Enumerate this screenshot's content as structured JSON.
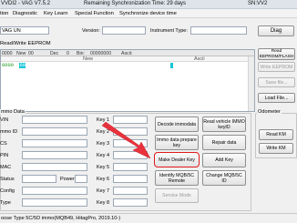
{
  "title": {
    "app": "VVDI2 - VAG V7.5.2",
    "sync": "Remaining Synchronization Time: 29 days",
    "serial": "SN:VV2"
  },
  "menu": [
    "tion",
    "Diagnostic",
    "Key Learn",
    "Special Function",
    "Synchronize device time"
  ],
  "info": {
    "vin_value": "VAG UN",
    "version_label": "Version:",
    "instrument_type_label": "Instrument Type:",
    "diag_label": "Diag"
  },
  "eeprom": {
    "title": "Read/Write EEPROM",
    "header": [
      "0000",
      "New",
      "00",
      "Dec",
      "0",
      "Bin:",
      "00000000",
      "Ascii:"
    ],
    "col_new": "New",
    "col_ascii": "Ascii",
    "row_addr": "0000",
    "row_byte": "00",
    "buttons": {
      "read": "Read\nEEPROM/FLASH",
      "write": "Write EEPROM",
      "save": "Save file...",
      "load": "Load File..."
    }
  },
  "immo": {
    "title": "mmo Data",
    "fields": [
      "VIN",
      "mmo ID",
      "CS",
      "PIN",
      "MAC",
      "Status",
      "Config",
      "Type"
    ],
    "power_label": "Power",
    "keys": [
      "Key 1",
      "Key 2",
      "Key 3",
      "Key 4",
      "Key 5",
      "Key 6",
      "Key 7",
      "Key 8"
    ]
  },
  "actions": {
    "decode": "Decode immodata",
    "read_vehicle": "Read vehicle IMMO keyID",
    "prepare": "Immo data prepare key",
    "repair": "Repair data",
    "make_dealer": "Make Dealer Key",
    "add_key": "Add Key",
    "identify": "Identify MQB/5C Remote",
    "change_id": "Change MQB/5C ID",
    "service": "Service Mode"
  },
  "odometer": {
    "title": "Odometer",
    "read": "Read KM",
    "write": "Write KM"
  },
  "status": "oose Type 5C/5D immo(MQB49, HitagPro, 2019.10-)",
  "colors": {
    "highlight_ring": "#e01b1b",
    "arrow": "#e8323c",
    "selected_cell": "#14c6d6"
  }
}
